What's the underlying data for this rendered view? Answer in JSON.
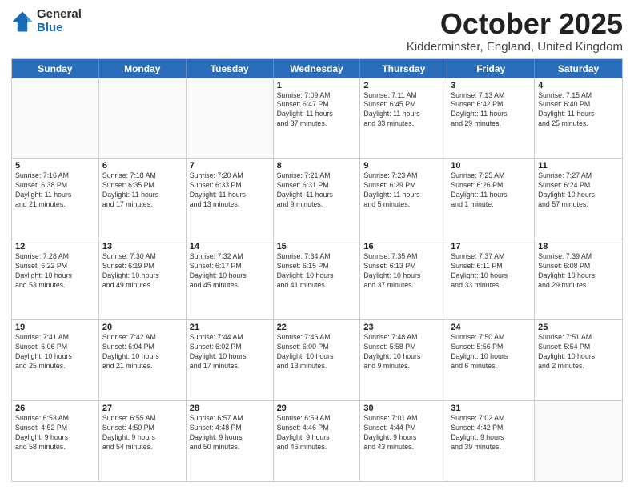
{
  "logo": {
    "general": "General",
    "blue": "Blue"
  },
  "title": "October 2025",
  "subtitle": "Kidderminster, England, United Kingdom",
  "days": [
    "Sunday",
    "Monday",
    "Tuesday",
    "Wednesday",
    "Thursday",
    "Friday",
    "Saturday"
  ],
  "weeks": [
    [
      {
        "day": "",
        "info": ""
      },
      {
        "day": "",
        "info": ""
      },
      {
        "day": "",
        "info": ""
      },
      {
        "day": "1",
        "info": "Sunrise: 7:09 AM\nSunset: 6:47 PM\nDaylight: 11 hours\nand 37 minutes."
      },
      {
        "day": "2",
        "info": "Sunrise: 7:11 AM\nSunset: 6:45 PM\nDaylight: 11 hours\nand 33 minutes."
      },
      {
        "day": "3",
        "info": "Sunrise: 7:13 AM\nSunset: 6:42 PM\nDaylight: 11 hours\nand 29 minutes."
      },
      {
        "day": "4",
        "info": "Sunrise: 7:15 AM\nSunset: 6:40 PM\nDaylight: 11 hours\nand 25 minutes."
      }
    ],
    [
      {
        "day": "5",
        "info": "Sunrise: 7:16 AM\nSunset: 6:38 PM\nDaylight: 11 hours\nand 21 minutes."
      },
      {
        "day": "6",
        "info": "Sunrise: 7:18 AM\nSunset: 6:35 PM\nDaylight: 11 hours\nand 17 minutes."
      },
      {
        "day": "7",
        "info": "Sunrise: 7:20 AM\nSunset: 6:33 PM\nDaylight: 11 hours\nand 13 minutes."
      },
      {
        "day": "8",
        "info": "Sunrise: 7:21 AM\nSunset: 6:31 PM\nDaylight: 11 hours\nand 9 minutes."
      },
      {
        "day": "9",
        "info": "Sunrise: 7:23 AM\nSunset: 6:29 PM\nDaylight: 11 hours\nand 5 minutes."
      },
      {
        "day": "10",
        "info": "Sunrise: 7:25 AM\nSunset: 6:26 PM\nDaylight: 11 hours\nand 1 minute."
      },
      {
        "day": "11",
        "info": "Sunrise: 7:27 AM\nSunset: 6:24 PM\nDaylight: 10 hours\nand 57 minutes."
      }
    ],
    [
      {
        "day": "12",
        "info": "Sunrise: 7:28 AM\nSunset: 6:22 PM\nDaylight: 10 hours\nand 53 minutes."
      },
      {
        "day": "13",
        "info": "Sunrise: 7:30 AM\nSunset: 6:19 PM\nDaylight: 10 hours\nand 49 minutes."
      },
      {
        "day": "14",
        "info": "Sunrise: 7:32 AM\nSunset: 6:17 PM\nDaylight: 10 hours\nand 45 minutes."
      },
      {
        "day": "15",
        "info": "Sunrise: 7:34 AM\nSunset: 6:15 PM\nDaylight: 10 hours\nand 41 minutes."
      },
      {
        "day": "16",
        "info": "Sunrise: 7:35 AM\nSunset: 6:13 PM\nDaylight: 10 hours\nand 37 minutes."
      },
      {
        "day": "17",
        "info": "Sunrise: 7:37 AM\nSunset: 6:11 PM\nDaylight: 10 hours\nand 33 minutes."
      },
      {
        "day": "18",
        "info": "Sunrise: 7:39 AM\nSunset: 6:08 PM\nDaylight: 10 hours\nand 29 minutes."
      }
    ],
    [
      {
        "day": "19",
        "info": "Sunrise: 7:41 AM\nSunset: 6:06 PM\nDaylight: 10 hours\nand 25 minutes."
      },
      {
        "day": "20",
        "info": "Sunrise: 7:42 AM\nSunset: 6:04 PM\nDaylight: 10 hours\nand 21 minutes."
      },
      {
        "day": "21",
        "info": "Sunrise: 7:44 AM\nSunset: 6:02 PM\nDaylight: 10 hours\nand 17 minutes."
      },
      {
        "day": "22",
        "info": "Sunrise: 7:46 AM\nSunset: 6:00 PM\nDaylight: 10 hours\nand 13 minutes."
      },
      {
        "day": "23",
        "info": "Sunrise: 7:48 AM\nSunset: 5:58 PM\nDaylight: 10 hours\nand 9 minutes."
      },
      {
        "day": "24",
        "info": "Sunrise: 7:50 AM\nSunset: 5:56 PM\nDaylight: 10 hours\nand 6 minutes."
      },
      {
        "day": "25",
        "info": "Sunrise: 7:51 AM\nSunset: 5:54 PM\nDaylight: 10 hours\nand 2 minutes."
      }
    ],
    [
      {
        "day": "26",
        "info": "Sunrise: 6:53 AM\nSunset: 4:52 PM\nDaylight: 9 hours\nand 58 minutes."
      },
      {
        "day": "27",
        "info": "Sunrise: 6:55 AM\nSunset: 4:50 PM\nDaylight: 9 hours\nand 54 minutes."
      },
      {
        "day": "28",
        "info": "Sunrise: 6:57 AM\nSunset: 4:48 PM\nDaylight: 9 hours\nand 50 minutes."
      },
      {
        "day": "29",
        "info": "Sunrise: 6:59 AM\nSunset: 4:46 PM\nDaylight: 9 hours\nand 46 minutes."
      },
      {
        "day": "30",
        "info": "Sunrise: 7:01 AM\nSunset: 4:44 PM\nDaylight: 9 hours\nand 43 minutes."
      },
      {
        "day": "31",
        "info": "Sunrise: 7:02 AM\nSunset: 4:42 PM\nDaylight: 9 hours\nand 39 minutes."
      },
      {
        "day": "",
        "info": ""
      }
    ]
  ]
}
